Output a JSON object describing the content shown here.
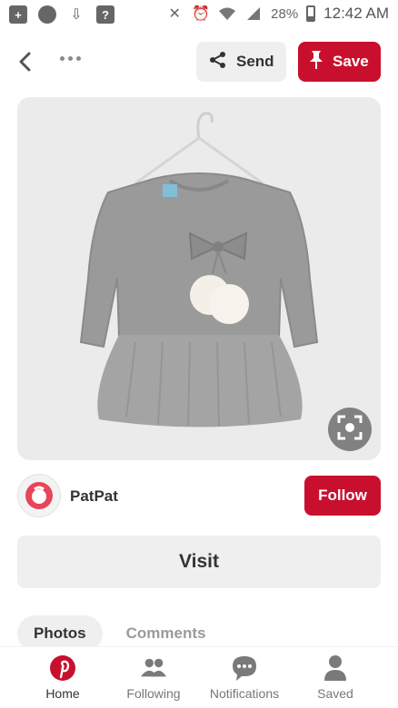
{
  "status_bar": {
    "battery_percent": "28%",
    "time": "12:42 AM",
    "left_icons": [
      "add-box-icon",
      "circle-icon",
      "download-icon",
      "help-icon"
    ],
    "right_icons": [
      "vibrate-off-icon",
      "alarm-icon",
      "wifi-icon",
      "cell-signal-icon",
      "battery-icon"
    ]
  },
  "toolbar": {
    "send_label": "Send",
    "save_label": "Save"
  },
  "pin": {
    "image_alt": "Gray knit top with bow and pom-pom and tulle skirt dress on hanger"
  },
  "creator": {
    "name": "PatPat",
    "follow_label": "Follow"
  },
  "visit_label": "Visit",
  "tabs": [
    {
      "label": "Photos",
      "active": true
    },
    {
      "label": "Comments",
      "active": false
    }
  ],
  "bottom_nav": [
    {
      "label": "Home",
      "icon": "pinterest-logo-icon",
      "active": true
    },
    {
      "label": "Following",
      "icon": "people-icon",
      "active": false
    },
    {
      "label": "Notifications",
      "icon": "speech-bubble-icon",
      "active": false
    },
    {
      "label": "Saved",
      "icon": "person-icon",
      "active": false
    }
  ],
  "colors": {
    "brand_red": "#c8102e",
    "button_gray": "#efefef",
    "text_dark": "#333333",
    "text_muted": "#9a9a9a"
  }
}
